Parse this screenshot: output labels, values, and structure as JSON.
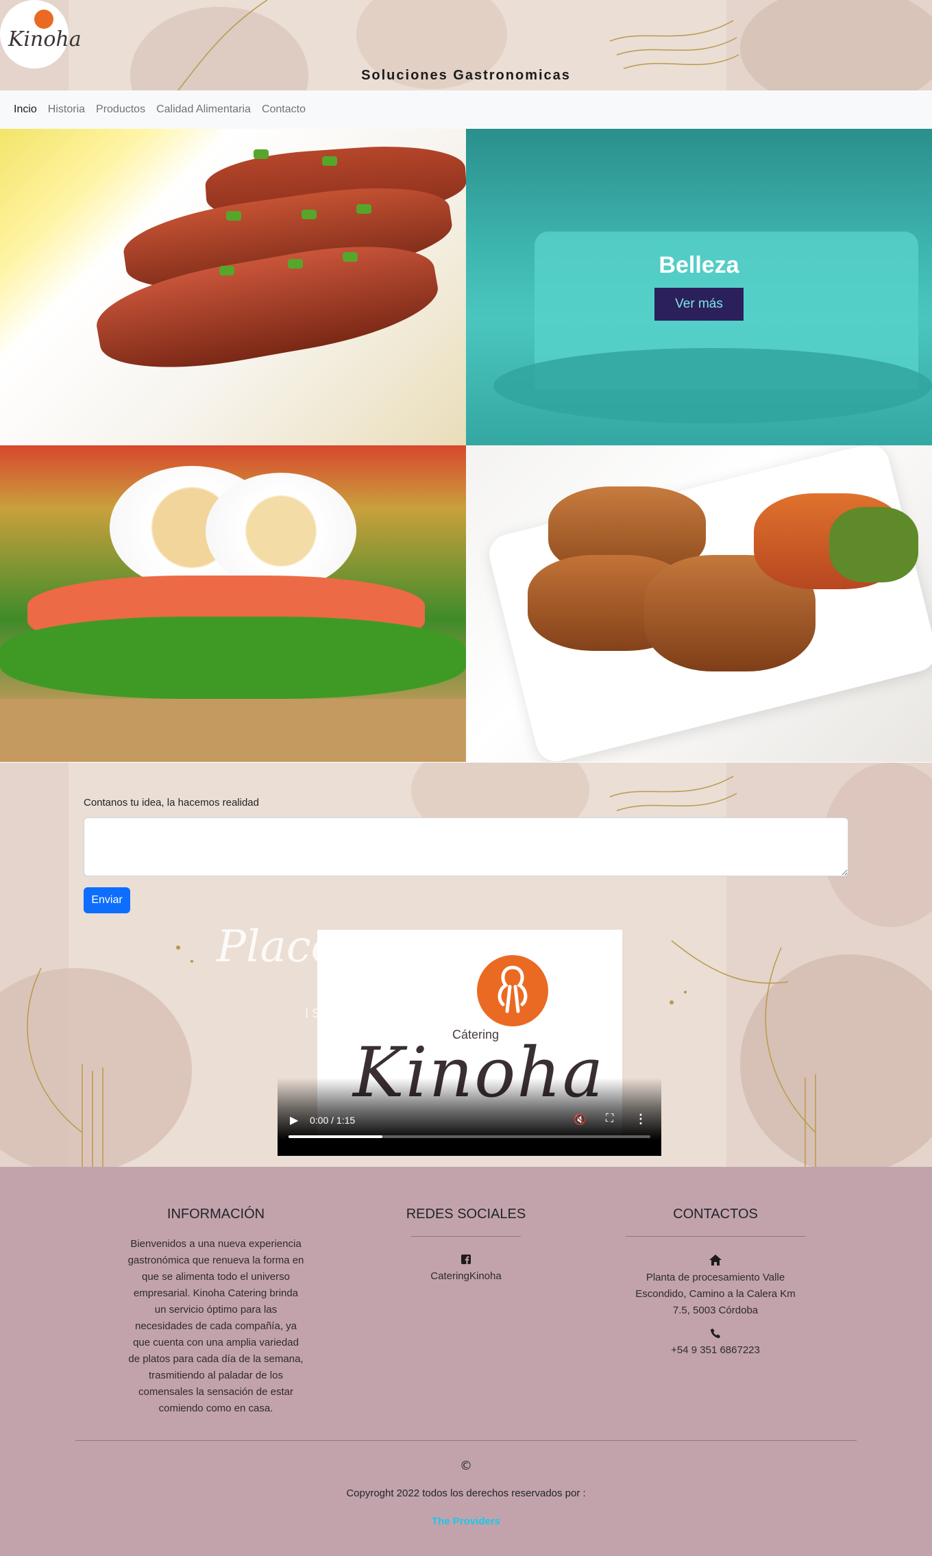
{
  "brand": {
    "logo_text": "Kinoha",
    "site_title": "Soluciones Gastronomicas"
  },
  "nav": {
    "items": [
      {
        "label": "Incio",
        "active": true
      },
      {
        "label": "Historia",
        "active": false
      },
      {
        "label": "Productos",
        "active": false
      },
      {
        "label": "Calidad Alimentaria",
        "active": false
      },
      {
        "label": "Contacto",
        "active": false
      }
    ]
  },
  "gallery": {
    "overlay_title": "Belleza",
    "overlay_button": "Ver más"
  },
  "form": {
    "label": "Contanos tu idea, la hacemos realidad",
    "textarea_value": "",
    "submit_label": "Enviar"
  },
  "video": {
    "background_script": "Place",
    "background_small": "I S",
    "logo_caption": "Cátering",
    "logo_word": "Kinoha",
    "time": "0:00 / 1:15",
    "progress": 0.26
  },
  "footer": {
    "info": {
      "heading": "INFORMACIÓN",
      "text": "Bienvenidos a una nueva experiencia gastronómica que renueva la forma en que se alimenta todo el universo empresarial. Kinoha Catering brinda un servicio óptimo para las necesidades de cada compañía, ya que cuenta con una amplia variedad de platos para cada día de la semana, trasmitiendo al paladar de los comensales la sensación de estar comiendo como en casa."
    },
    "social": {
      "heading": "REDES SOCIALES",
      "facebook_name": "CateringKinoha"
    },
    "contacts": {
      "heading": "CONTACTOS",
      "address": "Planta de procesamiento Valle Escondido, Camino a la Calera Km 7.5, 5003 Córdoba",
      "phone": "+54 9 351 6867223"
    },
    "copyright_symbol": "©",
    "copyright_text": "Copyroght 2022 todos los derechos reservados por :",
    "author_link": "The Providers"
  },
  "colors": {
    "accent": "#0d6efd",
    "footer_bg": "#c2a3ac",
    "overlay_button_bg": "#2b1f5c",
    "overlay_button_text": "#7de7e5",
    "author_link": "#19c9e6",
    "logo_orange": "#ea6a23"
  }
}
